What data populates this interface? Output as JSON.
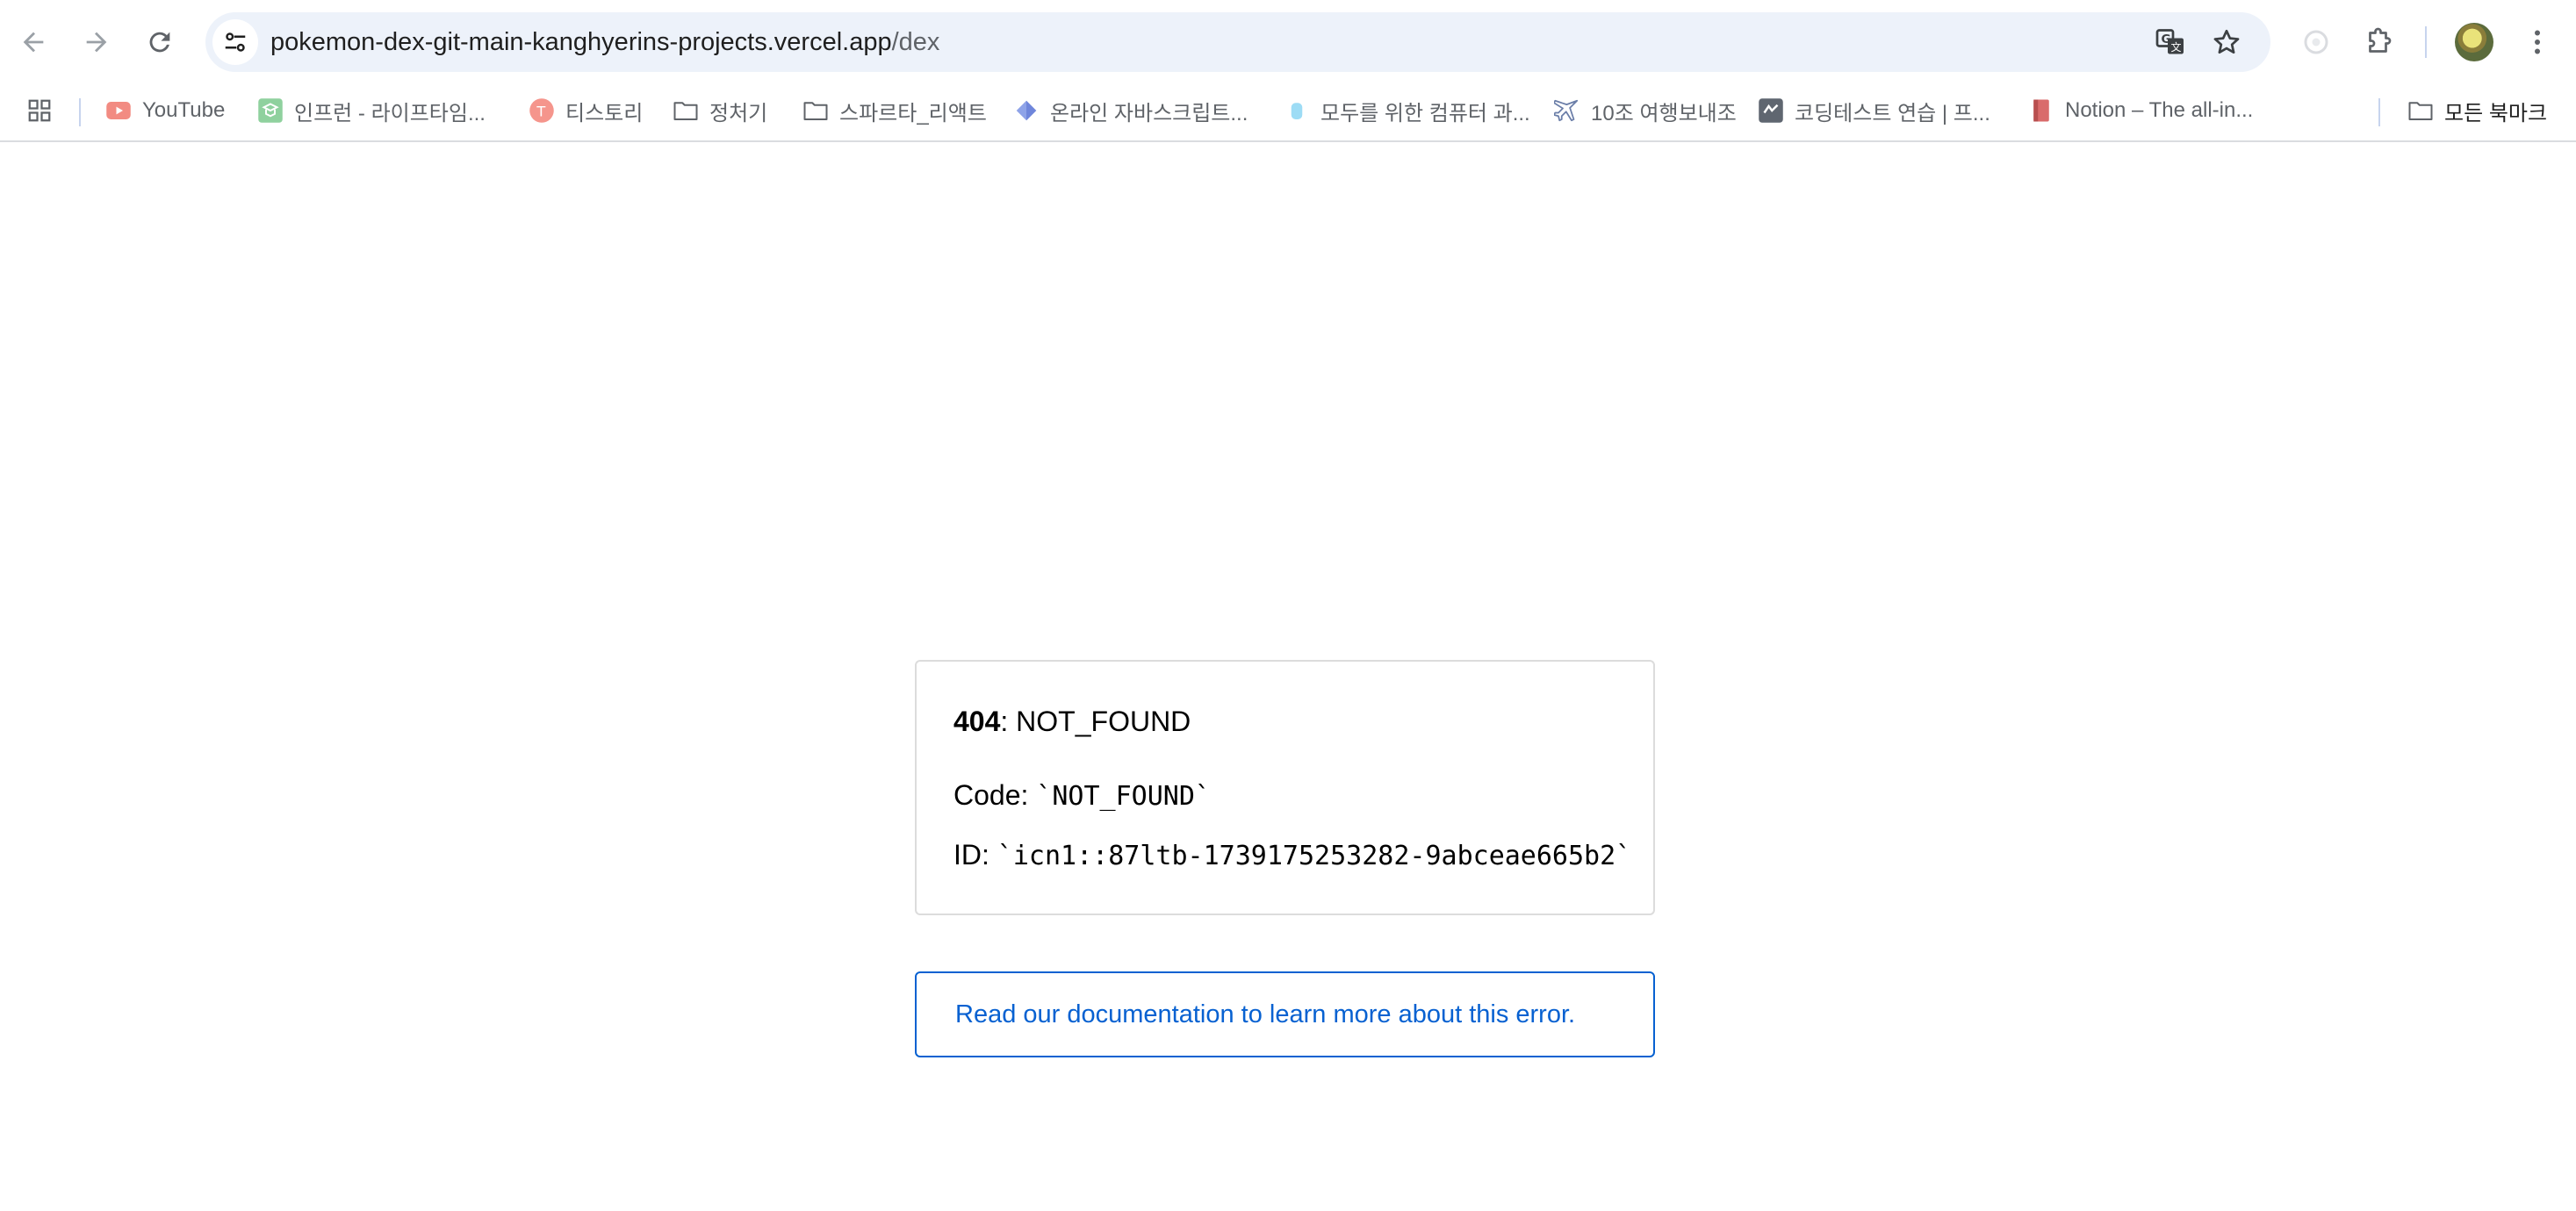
{
  "browser": {
    "url_host": "pokemon-dex-git-main-kanghyerins-projects.vercel.app",
    "url_path": "/dex"
  },
  "bookmarks": {
    "items": [
      {
        "label": "YouTube",
        "icon": "youtube-icon"
      },
      {
        "label": "인프런 - 라이프타임...",
        "icon": "inflearn-icon"
      },
      {
        "label": "티스토리",
        "icon": "tistory-icon"
      },
      {
        "label": "정처기",
        "icon": "folder-icon"
      },
      {
        "label": "스파르타_리액트",
        "icon": "folder-icon"
      },
      {
        "label": "온라인 자바스크립트...",
        "icon": "diamond-icon"
      },
      {
        "label": "모두를 위한 컴퓨터 과...",
        "icon": "drop-icon"
      },
      {
        "label": "10조 여행보내조",
        "icon": "airplane-icon"
      },
      {
        "label": "코딩테스트 연습 | 프...",
        "icon": "programmers-icon"
      },
      {
        "label": "Notion – The all-in...",
        "icon": "notion-icon"
      }
    ],
    "all_bookmarks": "모든 북마크"
  },
  "error": {
    "code_number": "404",
    "code_text": ": NOT_FOUND",
    "code_label": "Code: ",
    "code_value": "`NOT_FOUND`",
    "id_label": "ID: ",
    "id_value": "`icn1::87ltb-1739175253282-9abceae665b2`"
  },
  "doc_link": {
    "label": "Read our documentation to learn more about this error."
  },
  "colors": {
    "link": "#0761d1",
    "omnibox": "#edf2fa",
    "border": "#dcdcdc"
  }
}
